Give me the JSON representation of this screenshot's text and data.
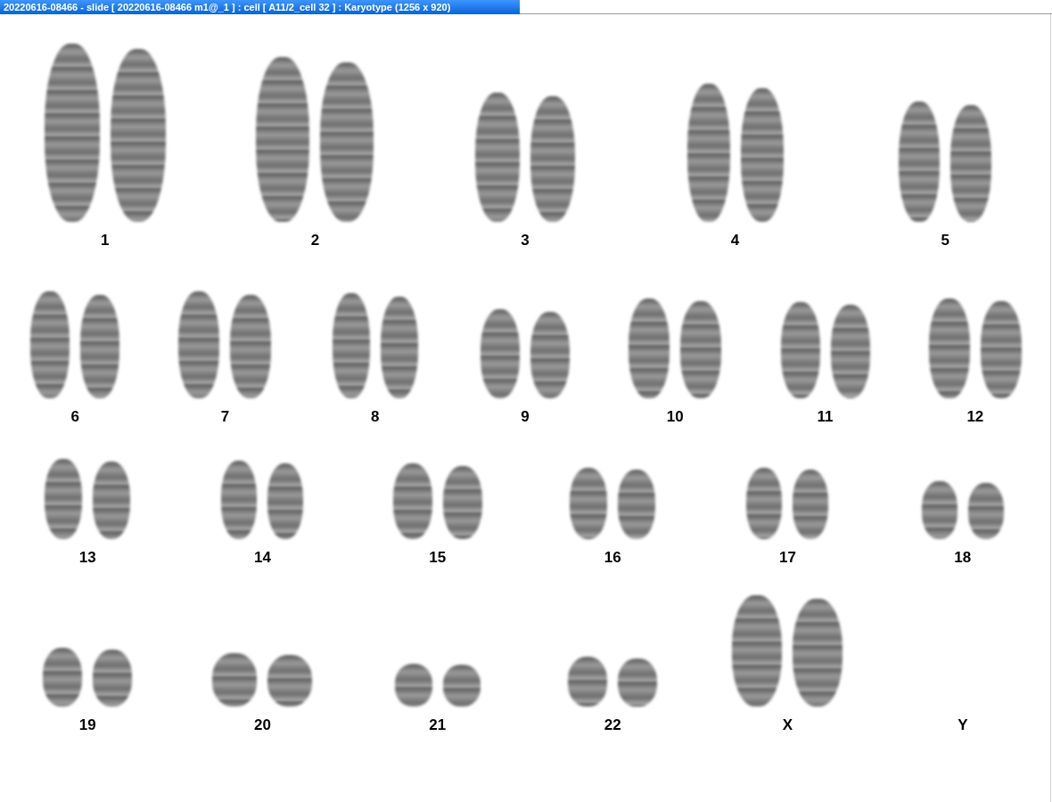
{
  "window": {
    "title": "20220616-08466 - slide [ 20220616-08466 m1@_1 ] : cell [ A11/2_cell 32 ] : Karyotype  (1256 x 920)"
  },
  "rows": [
    {
      "chromosomes": [
        {
          "label": "1",
          "kind": "pair"
        },
        {
          "label": "2",
          "kind": "pair"
        },
        {
          "label": "3",
          "kind": "pair"
        },
        {
          "label": "4",
          "kind": "pair"
        },
        {
          "label": "5",
          "kind": "pair"
        }
      ]
    },
    {
      "chromosomes": [
        {
          "label": "6",
          "kind": "pair"
        },
        {
          "label": "7",
          "kind": "pair"
        },
        {
          "label": "8",
          "kind": "pair"
        },
        {
          "label": "9",
          "kind": "pair"
        },
        {
          "label": "10",
          "kind": "pair"
        },
        {
          "label": "11",
          "kind": "pair"
        },
        {
          "label": "12",
          "kind": "pair"
        }
      ]
    },
    {
      "chromosomes": [
        {
          "label": "13",
          "kind": "pair"
        },
        {
          "label": "14",
          "kind": "pair"
        },
        {
          "label": "15",
          "kind": "pair"
        },
        {
          "label": "16",
          "kind": "pair"
        },
        {
          "label": "17",
          "kind": "pair"
        },
        {
          "label": "18",
          "kind": "pair"
        }
      ]
    },
    {
      "chromosomes": [
        {
          "label": "19",
          "kind": "pair"
        },
        {
          "label": "20",
          "kind": "pair"
        },
        {
          "label": "21",
          "kind": "pair"
        },
        {
          "label": "22",
          "kind": "pair"
        },
        {
          "label": "X",
          "kind": "pair"
        },
        {
          "label": "Y",
          "kind": "absent"
        }
      ]
    }
  ]
}
